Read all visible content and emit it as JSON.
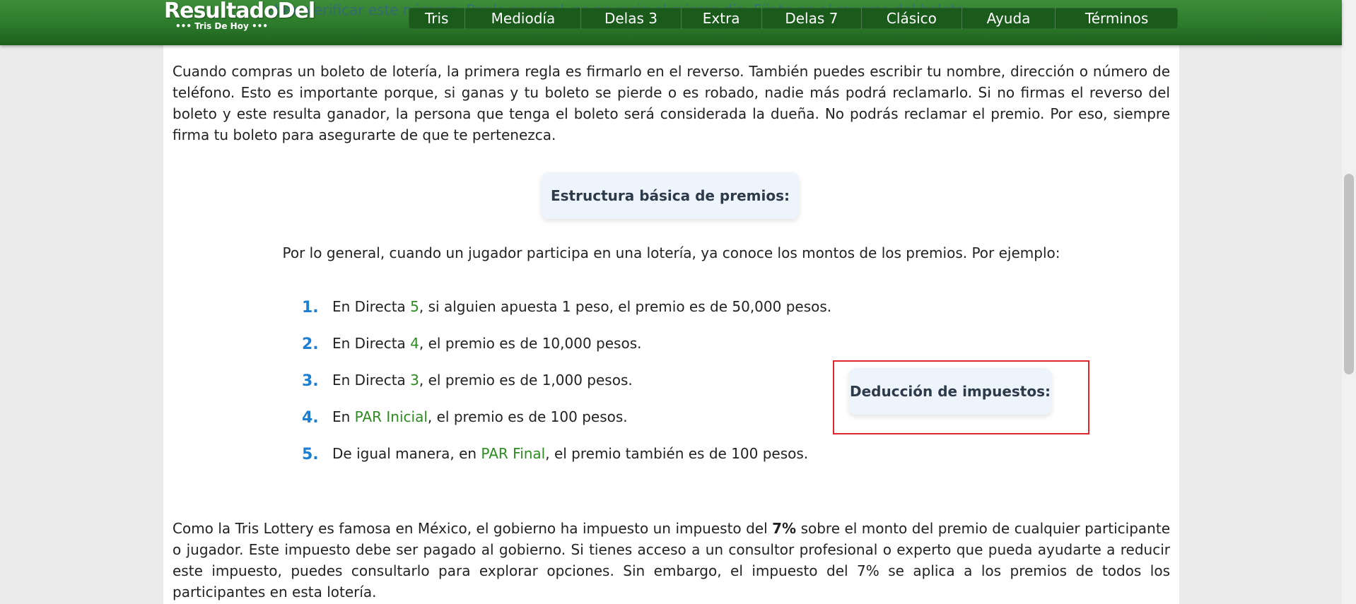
{
  "header": {
    "logo_main": "ResultadoDel",
    "logo_sub": "••• Tris De Hoy •••",
    "underlying_text": "eben verificar este número. Por lo general, se anuncia el mismo día. Fíjate en el reverso del boleto"
  },
  "nav": {
    "items": [
      "Tris",
      "Mediodía",
      "Delas 3",
      "Extra",
      "Delas 7",
      "Clásico",
      "Ayuda",
      "Términos"
    ]
  },
  "content": {
    "paragraph1": "Cuando compras un boleto de lotería, la primera regla es firmarlo en el reverso. También puedes escribir tu nombre, dirección o número de teléfono. Esto es importante porque, si ganas y tu boleto se pierde o es robado, nadie más podrá reclamarlo. Si no firmas el reverso del boleto y este resulta ganador, la persona que tenga el boleto será considerada la dueña. No podrás reclamar el premio. Por eso, siempre firma tu boleto para asegurarte de que te pertenezca.",
    "heading_premios": "Estructura básica de premios:",
    "intro": "Por lo general, cuando un jugador participa en una lotería, ya conoce los montos de los premios. Por ejemplo:",
    "list": [
      {
        "num": "1.",
        "pre": "En Directa ",
        "hl": "5",
        "post": ", si alguien apuesta 1 peso, el premio es de 50,000 pesos."
      },
      {
        "num": "2.",
        "pre": "En Directa ",
        "hl": "4",
        "post": ", el premio es de 10,000 pesos."
      },
      {
        "num": "3.",
        "pre": "En Directa ",
        "hl": "3",
        "post": ", el premio es de 1,000 pesos."
      },
      {
        "num": "4.",
        "pre": "En ",
        "hl": "PAR Inicial",
        "post": ", el premio es de 100 pesos."
      },
      {
        "num": "5.",
        "pre": "De igual manera, en ",
        "hl": "PAR Final",
        "post": ", el premio también es de 100 pesos."
      }
    ],
    "heading_impuestos": "Deducción de impuestos:",
    "p2_a": "Como la Tris Lottery es famosa en México, el gobierno ha impuesto un impuesto del ",
    "p2_bold": "7%",
    "p2_b": " sobre el monto del premio de cualquier participante o jugador. Este impuesto debe ser pagado al gobierno. Si tienes acceso a un consultor profesional o experto que pueda ayudarte a reducir este impuesto, puedes consultarlo para explorar opciones. Sin embargo, el impuesto del 7% se aplica a los premios de todos los participantes en esta lotería."
  },
  "colors": {
    "header_green": "#2c7a2b",
    "nav_dark_green": "#1a5a1b",
    "list_number_blue": "#1d7fd2",
    "highlight_green": "#2e8b22",
    "annotation_red": "#e0252d"
  }
}
